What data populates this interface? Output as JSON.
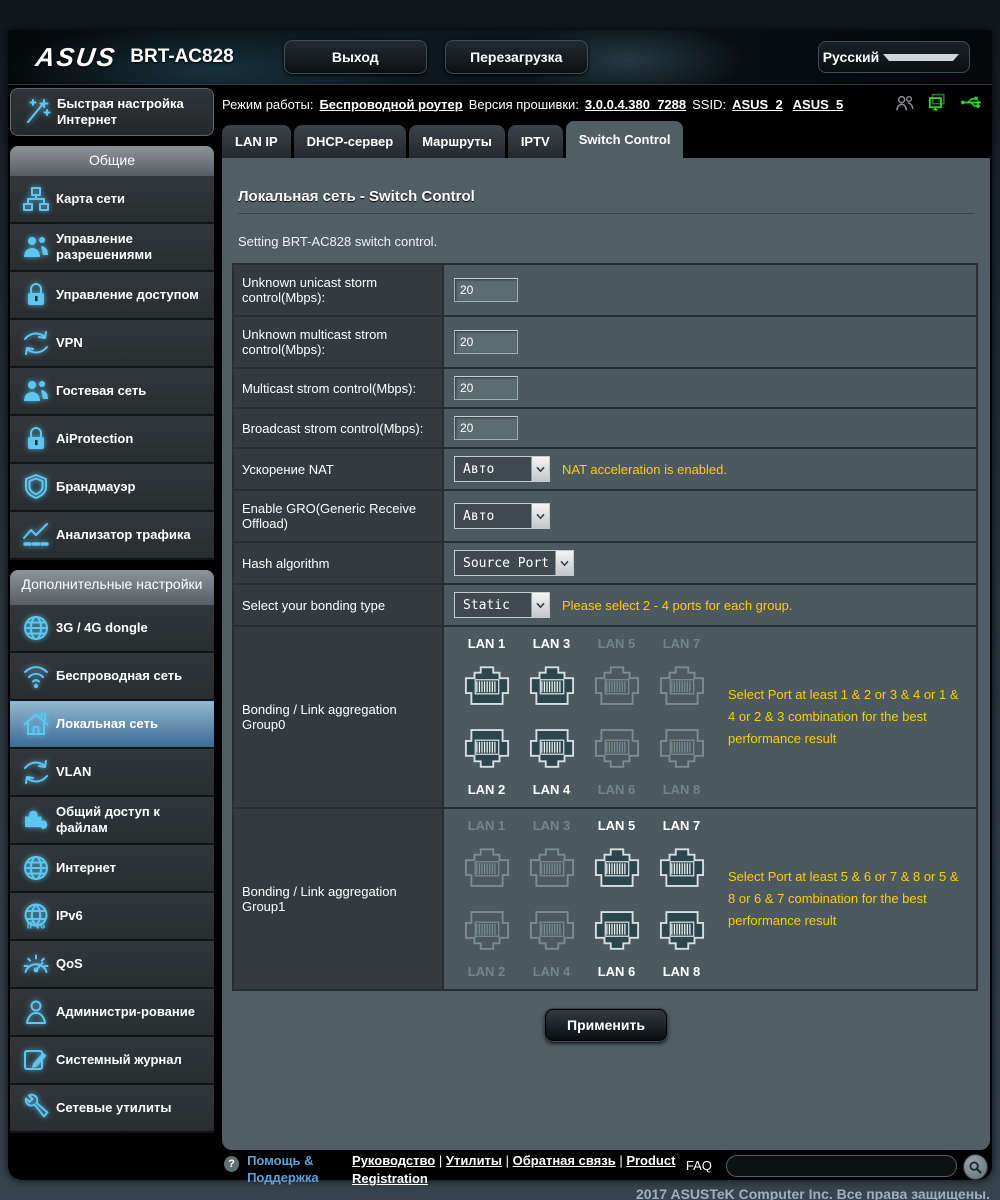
{
  "header": {
    "logo_text": "ASUS",
    "model": "BRT-AC828",
    "logout_label": "Выход",
    "reboot_label": "Перезагрузка",
    "language": "Русский"
  },
  "infobar": {
    "mode_label": "Режим работы:",
    "mode_value": "Беспроводной роутер",
    "fw_label": "Версия прошивки:",
    "fw_value": "3.0.0.4.380_7288",
    "ssid_label": "SSID:",
    "ssids": [
      "ASUS_2",
      "ASUS_5"
    ],
    "icons": [
      "clients-icon",
      "devices-icon",
      "usb-icon"
    ]
  },
  "tabs": [
    {
      "label": "LAN IP",
      "active": false
    },
    {
      "label": "DHCP-сервер",
      "active": false
    },
    {
      "label": "Маршруты",
      "active": false
    },
    {
      "label": "IPTV",
      "active": false
    },
    {
      "label": "Switch Control",
      "active": true
    }
  ],
  "sidebar": {
    "quick_setup": {
      "label": "Быстрая настройка Интернет",
      "icon": "wand"
    },
    "sections": [
      {
        "title": "Общие",
        "items": [
          {
            "label": "Карта сети",
            "icon": "map",
            "active": false
          },
          {
            "label": "Управление разрешениями",
            "icon": "users",
            "active": false
          },
          {
            "label": "Управление доступом",
            "icon": "lock",
            "active": false
          },
          {
            "label": "VPN",
            "icon": "arrows",
            "active": false
          },
          {
            "label": "Гостевая сеть",
            "icon": "users",
            "active": false
          },
          {
            "label": "AiProtection",
            "icon": "lock",
            "active": false
          },
          {
            "label": "Брандмауэр",
            "icon": "shield",
            "active": false
          },
          {
            "label": "Анализатор трафика",
            "icon": "traffic",
            "active": false
          }
        ]
      },
      {
        "title": "Дополнительные настройки",
        "items": [
          {
            "label": "3G / 4G dongle",
            "icon": "globe",
            "active": false
          },
          {
            "label": "Беспроводная сеть",
            "icon": "wifi",
            "active": false
          },
          {
            "label": "Локальная сеть",
            "icon": "home",
            "active": true
          },
          {
            "label": "VLAN",
            "icon": "arrows",
            "active": false
          },
          {
            "label": "Общий доступ к файлам",
            "icon": "puzzle",
            "active": false
          },
          {
            "label": "Интернет",
            "icon": "globe",
            "active": false
          },
          {
            "label": "IPv6",
            "icon": "ipv6",
            "active": false
          },
          {
            "label": "QoS",
            "icon": "gauge",
            "active": false
          },
          {
            "label": "Администри-рование",
            "icon": "admin",
            "active": false
          },
          {
            "label": "Системный журнал",
            "icon": "log",
            "active": false
          },
          {
            "label": "Сетевые утилиты",
            "icon": "wrench",
            "active": false
          }
        ]
      }
    ]
  },
  "page": {
    "title": "Локальная сеть - Switch Control",
    "description": "Setting BRT-AC828 switch control."
  },
  "form": {
    "rows": [
      {
        "label": "Unknown unicast storm control(Mbps):",
        "type": "input",
        "value": "20"
      },
      {
        "label": "Unknown multicast strom control(Mbps):",
        "type": "input",
        "value": "20"
      },
      {
        "label": "Multicast strom control(Mbps):",
        "type": "input",
        "value": "20"
      },
      {
        "label": "Broadcast strom control(Mbps):",
        "type": "input",
        "value": "20"
      },
      {
        "label": "Ускорение NAT",
        "type": "select",
        "value": "Авто",
        "hint": "NAT acceleration is enabled."
      },
      {
        "label": "Enable GRO(Generic Receive Offload)",
        "type": "select",
        "value": "Авто",
        "hint": ""
      },
      {
        "label": "Hash algorithm",
        "type": "select",
        "value": "Source Port",
        "hint": ""
      },
      {
        "label": "Select your bonding type",
        "type": "select",
        "value": "Static",
        "hint": "Please select 2 - 4 ports for each group."
      }
    ],
    "bonding_groups": [
      {
        "label": "Bonding / Link aggregation Group0",
        "top_ports": [
          {
            "name": "LAN 1",
            "active": true
          },
          {
            "name": "LAN 3",
            "active": true
          },
          {
            "name": "LAN 5",
            "active": false
          },
          {
            "name": "LAN 7",
            "active": false
          }
        ],
        "bottom_ports": [
          {
            "name": "LAN 2",
            "active": true
          },
          {
            "name": "LAN 4",
            "active": true
          },
          {
            "name": "LAN 6",
            "active": false
          },
          {
            "name": "LAN 8",
            "active": false
          }
        ],
        "hint": "Select Port at least 1 & 2 or 3 & 4 or 1 & 4 or 2 & 3 combination for the best performance result"
      },
      {
        "label": "Bonding / Link aggregation Group1",
        "top_ports": [
          {
            "name": "LAN 1",
            "active": false
          },
          {
            "name": "LAN 3",
            "active": false
          },
          {
            "name": "LAN 5",
            "active": true
          },
          {
            "name": "LAN 7",
            "active": true
          }
        ],
        "bottom_ports": [
          {
            "name": "LAN 2",
            "active": false
          },
          {
            "name": "LAN 4",
            "active": false
          },
          {
            "name": "LAN 6",
            "active": true
          },
          {
            "name": "LAN 8",
            "active": true
          }
        ],
        "hint": "Select Port at least 5 & 6 or 7 & 8 or 5 & 8 or 6 & 7 combination for the best performance result"
      }
    ],
    "apply_label": "Применить"
  },
  "footer": {
    "help": "Помощь & Поддержка",
    "links": [
      "Руководство",
      "Утилиты",
      "Обратная связь",
      "Product Registration"
    ],
    "faq_label": "FAQ",
    "search_value": ""
  },
  "copyright": "2017 ASUSTeK Computer Inc. Все права защищены.",
  "colors": {
    "accent_hint": "#ffcc00",
    "icon_glow": "#5ec6f2",
    "active_item": "#3c6b95",
    "port_active_fill": "#2d464e",
    "status_green": "#22cc22"
  }
}
